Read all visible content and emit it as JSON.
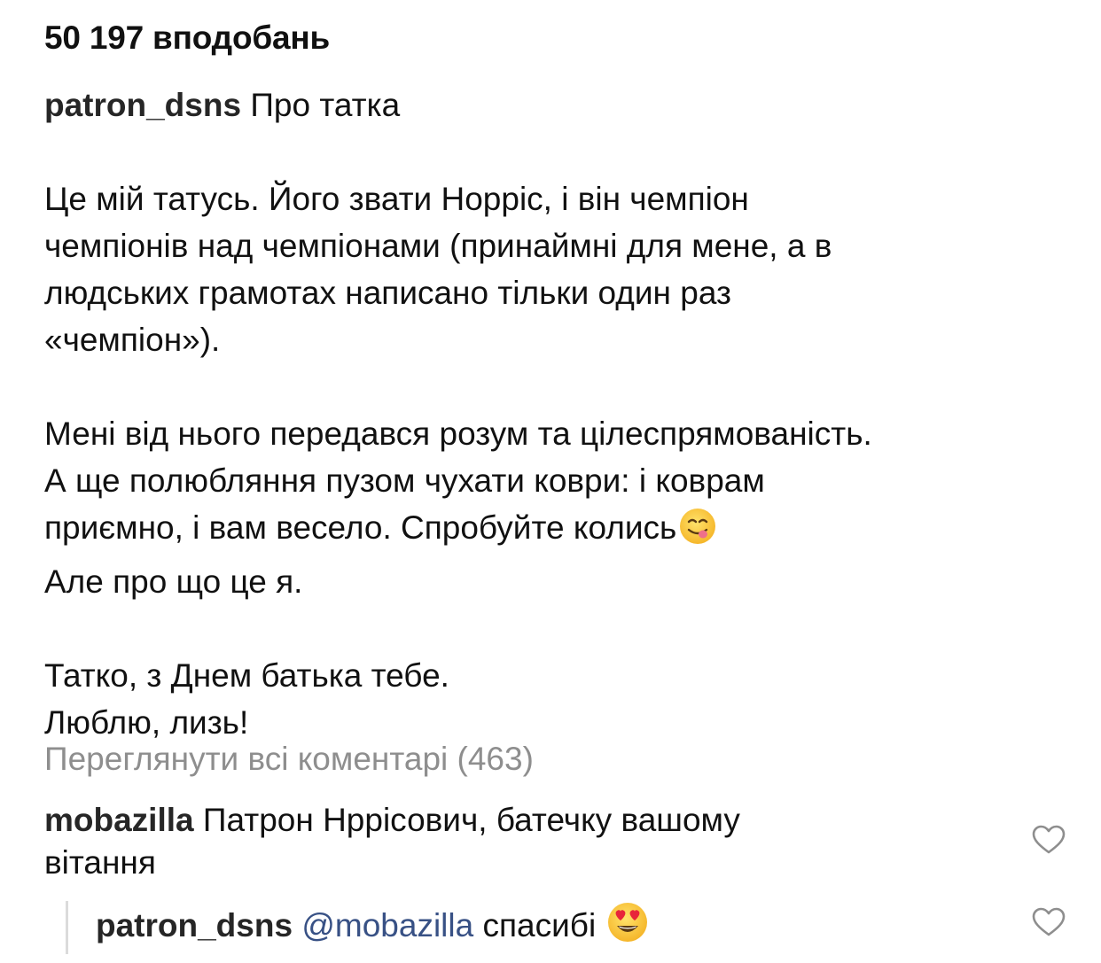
{
  "post": {
    "likes_text": "50 197 вподобань",
    "author": "patron_dsns",
    "caption_lines": [
      "Про татка",
      "",
      "Це мій татусь. Його звати Норріс, і він чемпіон",
      "чемпіонів над чемпіонами (принаймні для мене, а в",
      "людських грамотах написано тільки один раз",
      "«чемпіон»).",
      "",
      "Мені від нього передався розум та цілеспрямованість.",
      "А ще полюбляння пузом чухати коври: і коврам",
      "приємно, і вам весело. Спробуйте колись",
      "Але про що це я.",
      "",
      "Татко, з Днем батька тебе.",
      "Люблю, лизь!"
    ],
    "emojis": {
      "yum": "yum-face-emoji",
      "heart_eyes": "heart-eyes-emoji"
    }
  },
  "comments": {
    "view_all_label": "Переглянути всі коментарі (463)",
    "items": [
      {
        "username": "mobazilla",
        "text_line1": "Патрон Нррісович, батечку вашому",
        "text_line2": "вітання"
      }
    ],
    "reply": {
      "username": "patron_dsns",
      "mention": "@mobazilla",
      "text": "спасибі"
    }
  },
  "icons": {
    "like": "heart-outline-icon"
  },
  "colors": {
    "text": "#111111",
    "secondary_text": "#8e8e8e",
    "mention": "#385185",
    "reply_bar": "#dbdbdb"
  }
}
